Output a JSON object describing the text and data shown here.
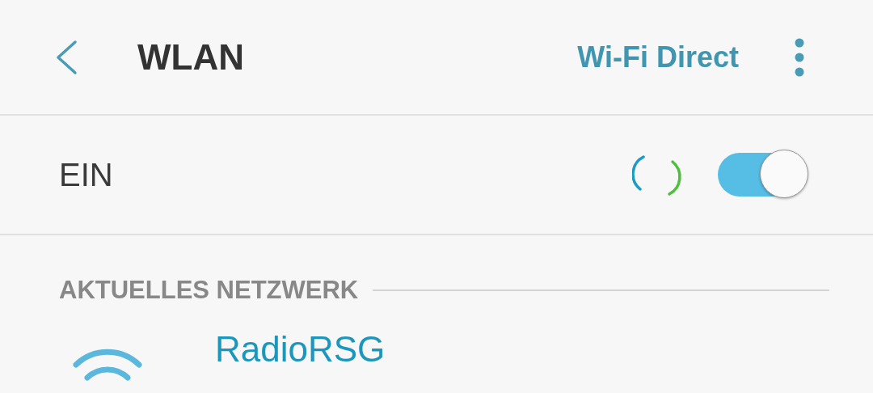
{
  "header": {
    "title": "WLAN",
    "action": "Wi-Fi Direct"
  },
  "master_switch": {
    "label": "EIN",
    "on": true,
    "scanning": true
  },
  "section": {
    "title": "AKTUELLES NETZWERK"
  },
  "networks": [
    {
      "name": "RadioRSG"
    }
  ]
}
